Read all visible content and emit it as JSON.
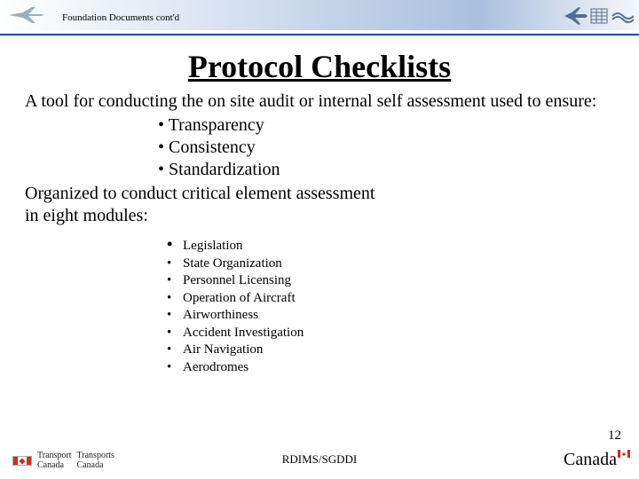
{
  "header": {
    "breadcrumb": "Foundation Documents cont'd"
  },
  "title": "Protocol Checklists",
  "intro": "A tool for conducting the on site audit or internal self assessment used to ensure:",
  "pillars": [
    "Transparency",
    "Consistency",
    "Standardization"
  ],
  "organized_line1": "Organized to conduct critical element assessment",
  "organized_line2": " in eight modules:",
  "modules": [
    "Legislation",
    "State Organization",
    "Personnel Licensing",
    "Operation of Aircraft",
    "Airworthiness",
    "Accident Investigation",
    "Air Navigation",
    "Aerodromes"
  ],
  "page_number": "12",
  "footer": {
    "center": "RDIMS/SGDDI",
    "dept_en": "Transport\nCanada",
    "dept_fr": "Transports\nCanada",
    "wordmark": "Canada"
  }
}
